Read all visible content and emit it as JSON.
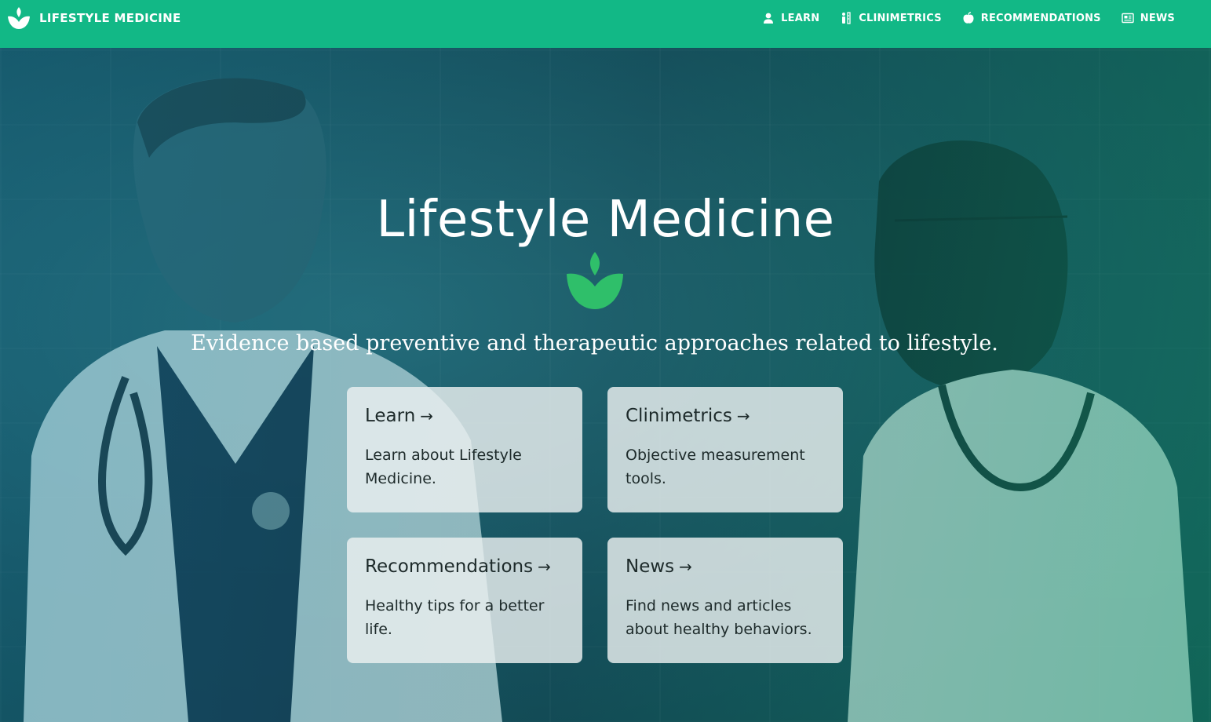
{
  "brand": {
    "name": "LIFESTYLE MEDICINE",
    "logo_icon": "leaf-logo-icon",
    "color": "#ffffff"
  },
  "nav": {
    "background": "#12b886",
    "items": [
      {
        "label": "LEARN",
        "icon": "person-icon"
      },
      {
        "label": "CLINIMETRICS",
        "icon": "measurement-icon"
      },
      {
        "label": "RECOMMENDATIONS",
        "icon": "apple-icon"
      },
      {
        "label": "NEWS",
        "icon": "newspaper-icon"
      }
    ]
  },
  "hero": {
    "title": "Lifestyle Medicine",
    "logo_icon": "leaf-logo-icon",
    "logo_color": "#2fbf6a",
    "subtitle": "Evidence based preventive and therapeutic approaches related to lifestyle."
  },
  "cards": [
    {
      "title": "Learn",
      "arrow": "→",
      "description": "Learn about Lifestyle Medicine."
    },
    {
      "title": "Clinimetrics",
      "arrow": "→",
      "description": "Objective measurement tools."
    },
    {
      "title": "Recommendations",
      "arrow": "→",
      "description": "Healthy tips for a better life."
    },
    {
      "title": "News",
      "arrow": "→",
      "description": "Find news and articles about healthy behaviors."
    }
  ]
}
